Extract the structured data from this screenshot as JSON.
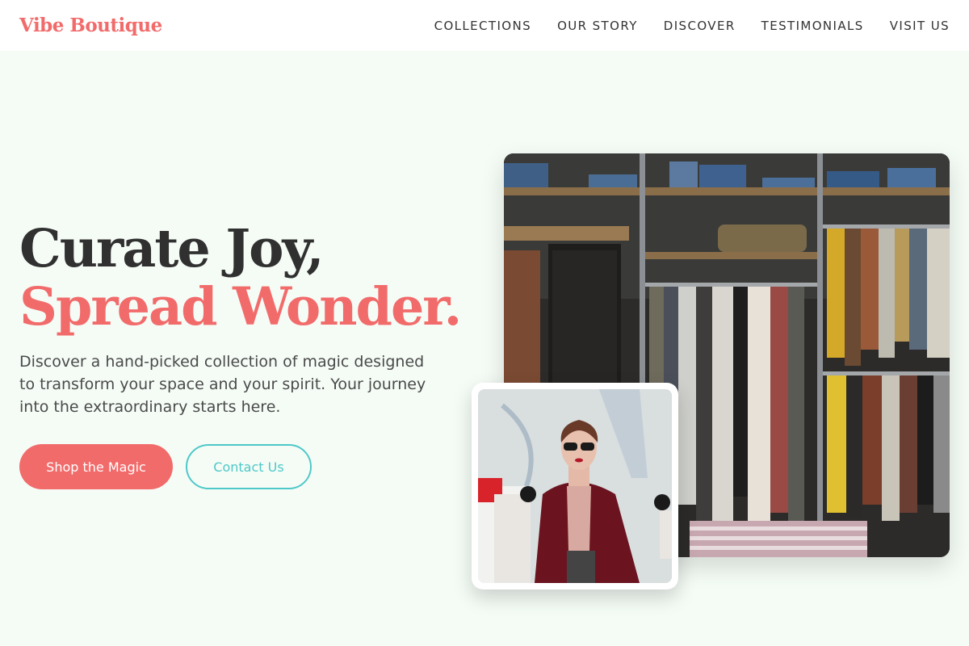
{
  "brand": {
    "name": "Vibe Boutique",
    "accent": "#f26b6b",
    "secondary": "#4ec8c8"
  },
  "nav": {
    "items": [
      {
        "label": "COLLECTIONS"
      },
      {
        "label": "OUR STORY"
      },
      {
        "label": "DISCOVER"
      },
      {
        "label": "TESTIMONIALS"
      },
      {
        "label": "VISIT US"
      }
    ]
  },
  "hero": {
    "headline_line1": "Curate Joy,",
    "headline_line2": "Spread Wonder.",
    "subtext": "Discover a hand-picked collection of magic designed to transform your space and your spirit. Your journey into the extraordinary starts here.",
    "primary_button": "Shop the Magic",
    "secondary_button": "Contact Us"
  },
  "images": {
    "main": "clothing-rack-photo",
    "inset": "shopper-photo"
  }
}
